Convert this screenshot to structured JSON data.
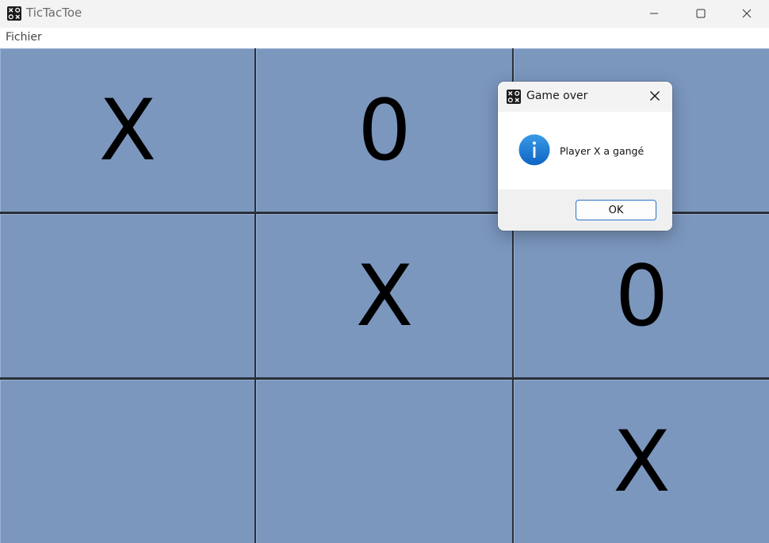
{
  "window": {
    "title": "TicTacToe",
    "app_icon": "tictactoe-grid-icon",
    "controls": [
      "minimize-icon",
      "maximize-icon",
      "close-icon"
    ]
  },
  "menubar": {
    "items": [
      {
        "label": "Fichier"
      }
    ]
  },
  "board": {
    "cells": [
      {
        "row": 1,
        "col": 1,
        "mark": "X"
      },
      {
        "row": 1,
        "col": 2,
        "mark": "0"
      },
      {
        "row": 1,
        "col": 3,
        "mark": ""
      },
      {
        "row": 2,
        "col": 1,
        "mark": ""
      },
      {
        "row": 2,
        "col": 2,
        "mark": "X"
      },
      {
        "row": 2,
        "col": 3,
        "mark": "0"
      },
      {
        "row": 3,
        "col": 1,
        "mark": ""
      },
      {
        "row": 3,
        "col": 2,
        "mark": ""
      },
      {
        "row": 3,
        "col": 3,
        "mark": "X"
      }
    ],
    "cell_color": "#7b97be",
    "grid_color": "#2a2f38"
  },
  "dialog": {
    "title": "Game over",
    "icon": "tictactoe-grid-icon",
    "message_icon": "info-icon",
    "message": "Player X a gangé",
    "ok_label": "OK",
    "accent_color": "#2a72c9"
  }
}
